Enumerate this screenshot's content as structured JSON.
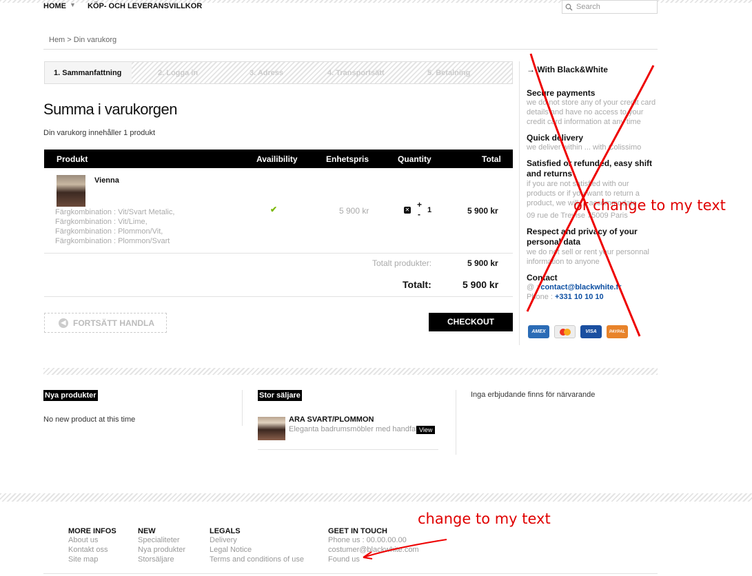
{
  "nav": {
    "home": "HOME",
    "terms": "KÖP- OCH LEVERANSVILLKOR",
    "search_placeholder": "Search"
  },
  "breadcrumb": "Hem > Din varukorg",
  "steps": [
    "1. Sammanfattning",
    "2. Logga in",
    "3. Adress",
    "4. Transportsätt",
    "5. Betalning"
  ],
  "cart": {
    "title": "Summa i varukorgen",
    "subtitle": "Din varukorg innehåller 1 produkt",
    "headers": {
      "product": "Produkt",
      "availability": "Availibility",
      "unit_price": "Enhetspris",
      "quantity": "Quantity",
      "total": "Total"
    },
    "item": {
      "name": "Vienna",
      "options": [
        "Färgkombination : Vit/Svart Metalic,",
        "Färgkombination : Vit/Lime,",
        "Färgkombination : Plommon/Vit,",
        "Färgkombination : Plommon/Svart"
      ],
      "availability_icon": "check-icon",
      "unit_price": "5 900 kr",
      "quantity": "1",
      "total": "5 900 kr"
    },
    "total_products_label": "Totalt produkter:",
    "total_products_value": "5 900 kr",
    "total_label": "Totalt:",
    "total_value": "5 900 kr",
    "continue_label": "FORTSÄTT HANDLA",
    "checkout_label": "CHECKOUT"
  },
  "sidebar": {
    "title": "With Black&White",
    "blocks": [
      {
        "h": "Secure payments",
        "t": "we do not store any of your credit card details and have no access to your credit card information at any time"
      },
      {
        "h": "Quick delivery",
        "t": "we deliver within ... with Colissimo"
      },
      {
        "h": "Satisfied or refunded, easy shift and returns",
        "t": "if you are not satisfied with our products or if you want to return a product, we will ... accommodate"
      },
      {
        "h": "",
        "t": "09 rue de Trevise 75009 Paris"
      },
      {
        "h": "Respect and privacy of your personal data",
        "t": "we do not sell or rent your personnal information to anyone"
      }
    ],
    "contact_h": "Contact",
    "email_prefix": "@ :",
    "email": "contact@blackwhite.fr",
    "phone_prefix": "Phone :",
    "phone": "+331 10 10 10",
    "cards": [
      "AMEX",
      "",
      "VISA",
      "PAYPAL"
    ]
  },
  "annotations": {
    "sidebar_note": "or change to my text",
    "footer_note": "change to my text"
  },
  "blocks": {
    "new_title": "Nya produkter",
    "new_text": "No new product at this time",
    "best_title": "Stor säljare",
    "best_name": "ARA SVART/PLOMMON",
    "best_desc": "Eleganta badrumsmöbler med handfat",
    "best_view": "View",
    "offers_text": "Inga erbjudande finns för närvarande"
  },
  "footer": {
    "cols": [
      {
        "h": "MORE INFOS",
        "items": [
          "About us",
          "Kontakt oss",
          "Site map"
        ]
      },
      {
        "h": "NEW",
        "items": [
          "Specialiteter",
          "Nya produkter",
          "Storsäljare"
        ]
      },
      {
        "h": "LEGALS",
        "items": [
          "Delivery",
          "Legal Notice",
          "Terms and conditions of use"
        ]
      },
      {
        "h": "GEET IN TOUCH",
        "items": [
          "Phone us : 00.00.00.00",
          "costumer@blackwhite.com",
          "Found us"
        ]
      }
    ]
  }
}
